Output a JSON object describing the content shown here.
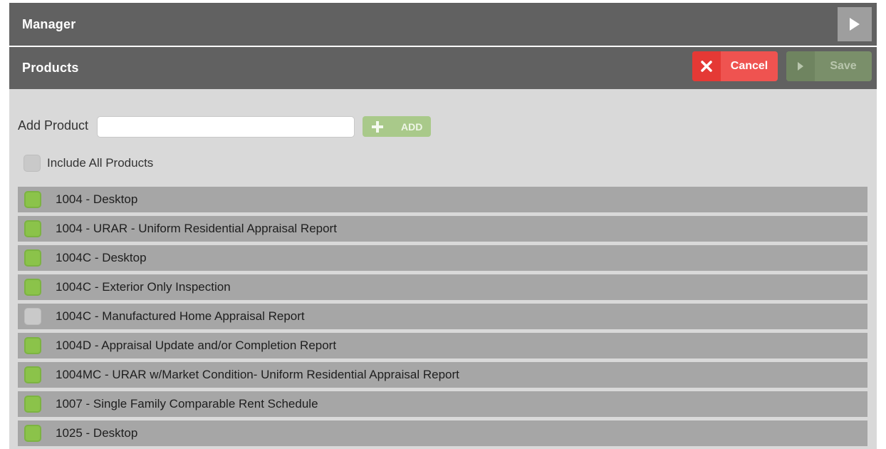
{
  "manager": {
    "title": "Manager"
  },
  "products": {
    "title": "Products",
    "cancel_label": "Cancel",
    "save_label": "Save"
  },
  "add_product": {
    "label": "Add Product",
    "value": "",
    "placeholder": "",
    "button_label": "ADD"
  },
  "include_all": {
    "label": "Include All Products",
    "checked": false
  },
  "items": [
    {
      "label": "1004 - Desktop",
      "checked": true
    },
    {
      "label": "1004 - URAR - Uniform Residential Appraisal Report",
      "checked": true
    },
    {
      "label": "1004C - Desktop",
      "checked": true
    },
    {
      "label": "1004C - Exterior Only Inspection",
      "checked": true
    },
    {
      "label": "1004C - Manufactured Home Appraisal Report",
      "checked": false
    },
    {
      "label": "1004D - Appraisal Update and/or Completion Report",
      "checked": true
    },
    {
      "label": "1004MC - URAR w/Market Condition- Uniform Residential Appraisal Report",
      "checked": true
    },
    {
      "label": "1007 - Single Family Comparable Rent Schedule",
      "checked": true
    },
    {
      "label": "1025 - Desktop",
      "checked": true
    }
  ],
  "colors": {
    "header": "#616161",
    "cancel": "#ef5350",
    "save": "#7a8f6a",
    "checked": "#8bc34a",
    "row": "#a6a6a6"
  },
  "icons": {
    "expand": "play-triangle-icon",
    "cancel": "x-icon",
    "save": "play-triangle-icon",
    "add": "plus-icon"
  }
}
